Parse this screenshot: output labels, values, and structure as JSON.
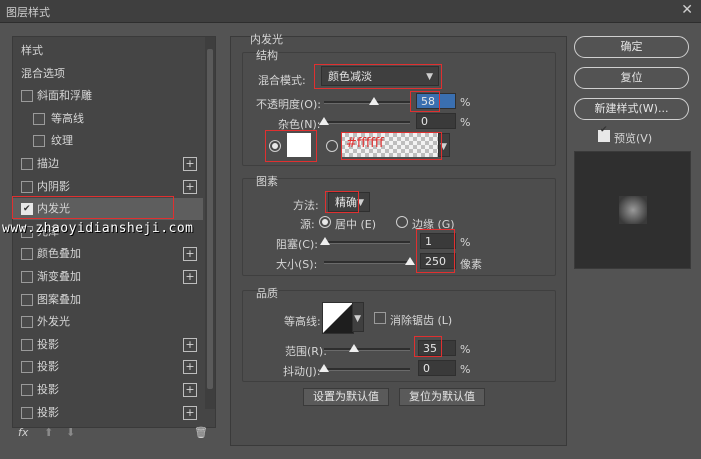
{
  "window": {
    "title": "图层样式",
    "close": "✕"
  },
  "styles_list": {
    "items": [
      {
        "label": "样式",
        "checkbox": false
      },
      {
        "label": "混合选项",
        "checkbox": false
      },
      {
        "label": "斜面和浮雕",
        "checkbox": true,
        "checked": false
      },
      {
        "label": "等高线",
        "checkbox": true,
        "checked": false,
        "indent": true
      },
      {
        "label": "纹理",
        "checkbox": true,
        "checked": false,
        "indent": true
      },
      {
        "label": "描边",
        "checkbox": true,
        "checked": false,
        "plus": true
      },
      {
        "label": "内阴影",
        "checkbox": true,
        "checked": false,
        "plus": true
      },
      {
        "label": "内发光",
        "checkbox": true,
        "checked": true,
        "selected": true
      },
      {
        "label": "光泽",
        "checkbox": true,
        "checked": false
      },
      {
        "label": "颜色叠加",
        "checkbox": true,
        "checked": false,
        "plus": true
      },
      {
        "label": "渐变叠加",
        "checkbox": true,
        "checked": false,
        "plus": true
      },
      {
        "label": "图案叠加",
        "checkbox": true,
        "checked": false
      },
      {
        "label": "外发光",
        "checkbox": true,
        "checked": false
      },
      {
        "label": "投影",
        "checkbox": true,
        "checked": false,
        "plus": true
      },
      {
        "label": "投影",
        "checkbox": true,
        "checked": false,
        "plus": true
      },
      {
        "label": "投影",
        "checkbox": true,
        "checked": false,
        "plus": true
      },
      {
        "label": "投影",
        "checkbox": true,
        "checked": false,
        "plus": true
      }
    ],
    "footer": {
      "fx": "fx",
      "up": "⬆",
      "down": "⬇",
      "trash": "🗑"
    }
  },
  "watermark": "www.zhaoyidiansheji.com",
  "inner_glow": {
    "heading": "内发光",
    "structure": {
      "title": "结构",
      "blend_mode_label": "混合模式:",
      "blend_mode_value": "颜色减淡",
      "opacity_label": "不透明度(O):",
      "opacity_value": "58",
      "opacity_unit": "%",
      "opacity_level": 0.58,
      "noise_label": "杂色(N):",
      "noise_value": "0",
      "noise_unit": "%",
      "noise_level": 0,
      "color_hex": "#ffffff",
      "color_hex_label": "#ffffff"
    },
    "elements": {
      "title": "图素",
      "method_label": "方法:",
      "method_value": "精确",
      "source_label": "源:",
      "source_center": "居中 (E)",
      "source_edge": "边缘 (G)",
      "choke_label": "阻塞(C):",
      "choke_value": "1",
      "choke_unit": "%",
      "choke_level": 0.01,
      "size_label": "大小(S):",
      "size_value": "250",
      "size_unit": "像素",
      "size_level": 1.0
    },
    "quality": {
      "title": "品质",
      "contour_label": "等高线:",
      "anti_alias_label": "消除锯齿 (L)",
      "range_label": "范围(R):",
      "range_value": "35",
      "range_unit": "%",
      "range_level": 0.35,
      "jitter_label": "抖动(J):",
      "jitter_value": "0",
      "jitter_unit": "%",
      "jitter_level": 0
    },
    "make_default": "设置为默认值",
    "reset_default": "复位为默认值"
  },
  "right": {
    "ok": "确定",
    "reset": "复位",
    "new_style": "新建样式(W)...",
    "preview_label": "预览(V)"
  }
}
